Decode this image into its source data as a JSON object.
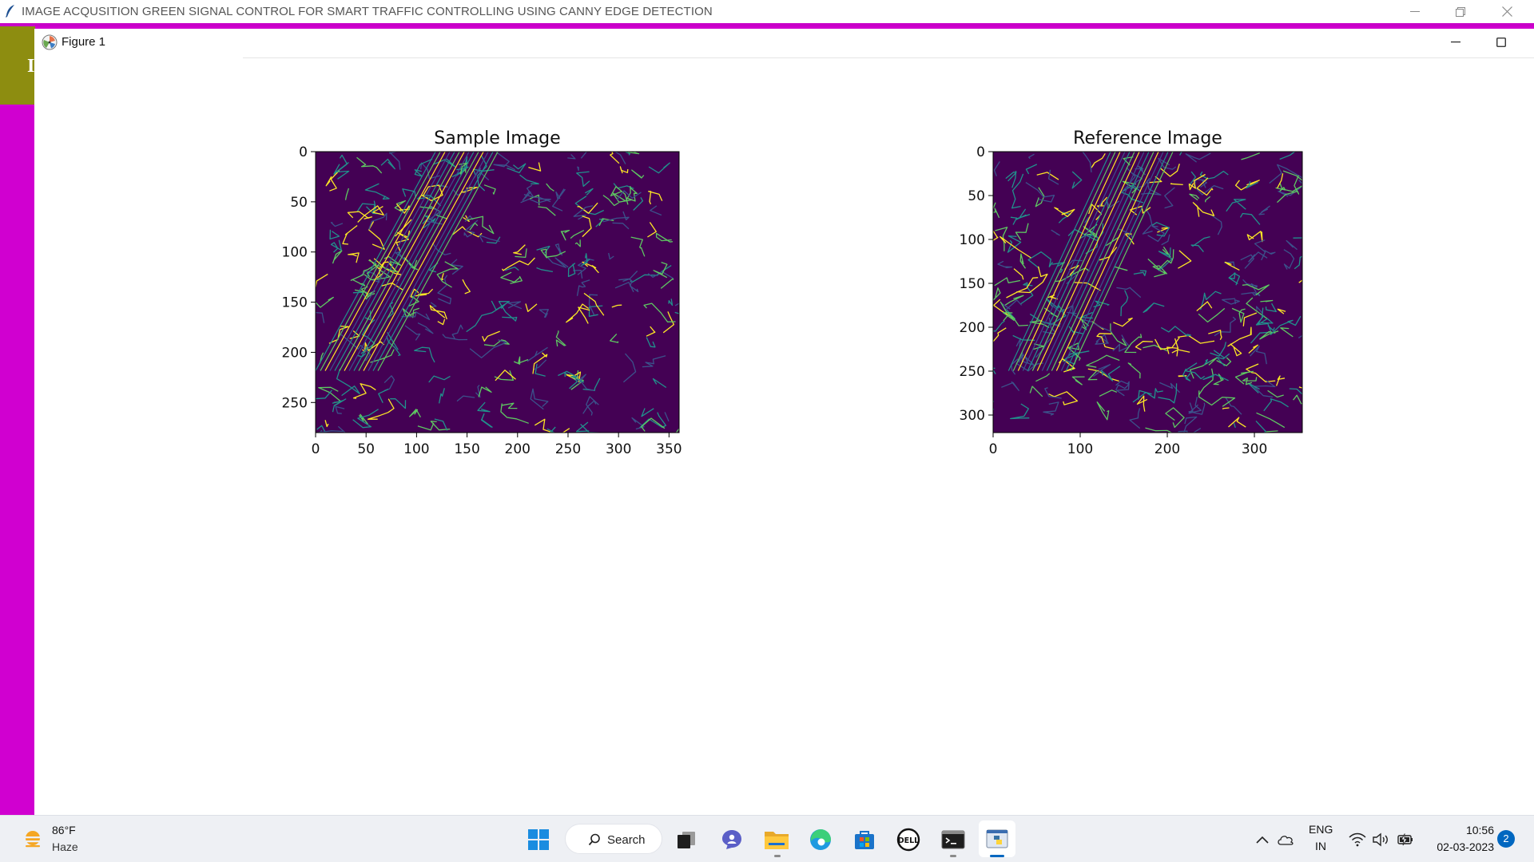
{
  "window": {
    "title": "IMAGE ACQUSITION GREEN SIGNAL CONTROL FOR SMART TRAFFIC CONTROLLING USING CANNY EDGE DETECTION",
    "background_app_letter": "I"
  },
  "figure": {
    "title": "Figure 1"
  },
  "chart_data": [
    {
      "type": "heatmap",
      "title": "Sample Image",
      "xlim": [
        0,
        360
      ],
      "ylim": [
        280,
        0
      ],
      "xticks": [
        0,
        50,
        100,
        150,
        200,
        250,
        300,
        350
      ],
      "yticks": [
        0,
        50,
        100,
        150,
        200,
        250
      ],
      "colormap": "viridis",
      "background_color": "#440154",
      "edge_colors": [
        "#21918c",
        "#5ec962",
        "#fde725",
        "#3b528b"
      ]
    },
    {
      "type": "heatmap",
      "title": "Reference Image",
      "xlim": [
        0,
        355
      ],
      "ylim": [
        320,
        0
      ],
      "xticks": [
        0,
        100,
        200,
        300
      ],
      "yticks": [
        0,
        50,
        100,
        150,
        200,
        250,
        300
      ],
      "colormap": "viridis",
      "background_color": "#440154",
      "edge_colors": [
        "#21918c",
        "#5ec962",
        "#fde725",
        "#3b528b"
      ]
    }
  ],
  "taskbar": {
    "weather": {
      "temp": "86°F",
      "condition": "Haze"
    },
    "search_label": "Search",
    "apps": [
      "windows-start",
      "search",
      "task-view",
      "teams-chat",
      "file-explorer",
      "edge",
      "microsoft-store",
      "dell",
      "terminal",
      "python-idle"
    ],
    "language": {
      "line1": "ENG",
      "line2": "IN"
    },
    "clock": {
      "time": "10:56",
      "date": "02-03-2023"
    },
    "notifications": "2"
  }
}
